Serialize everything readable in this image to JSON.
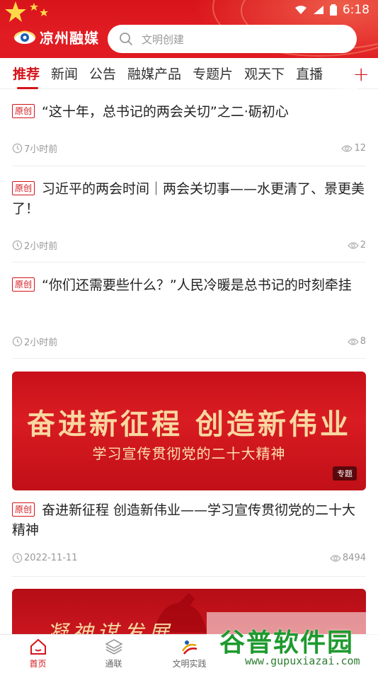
{
  "status_bar": {
    "time": "6:18"
  },
  "header": {
    "logo_text": "凉州融媒",
    "search_placeholder": "文明创建"
  },
  "tabs": [
    {
      "label": "推荐",
      "active": true
    },
    {
      "label": "新闻"
    },
    {
      "label": "公告"
    },
    {
      "label": "融媒产品"
    },
    {
      "label": "专题片"
    },
    {
      "label": "观天下"
    },
    {
      "label": "直播"
    }
  ],
  "tab_add_label": "+",
  "feed": {
    "badge": "原创",
    "items": [
      {
        "title": "“这十年，总书记的两会关切”之二·砺初心",
        "time": "7小时前",
        "views": "12"
      },
      {
        "title": "习近平的两会时间｜两会关切事——水更清了、景更美了！",
        "time": "2小时前",
        "views": "2"
      },
      {
        "title": "“你们还需要些什么？”人民冷暖是总书记的时刻牵挂",
        "time": "2小时前",
        "views": "8"
      },
      {
        "title": "奋进新征程 创造新伟业——学习宣传贯彻党的二十大精神",
        "time": "2022-11-11",
        "views": "8494"
      }
    ],
    "banner": {
      "main": "奋进新征程  创造新伟业",
      "sub": "学习宣传贯彻党的二十大精神",
      "tag": "专题"
    },
    "banner2": {
      "main": "凝神谋发展 "
    }
  },
  "bottom_nav": [
    {
      "label": "首页",
      "active": true
    },
    {
      "label": "通联"
    },
    {
      "label": "文明实践"
    }
  ],
  "watermark": {
    "title": "谷普软件园",
    "url": "www.gupuxiazai.com"
  },
  "colors": {
    "accent": "#d4141a",
    "header_red": "#e11d23"
  }
}
